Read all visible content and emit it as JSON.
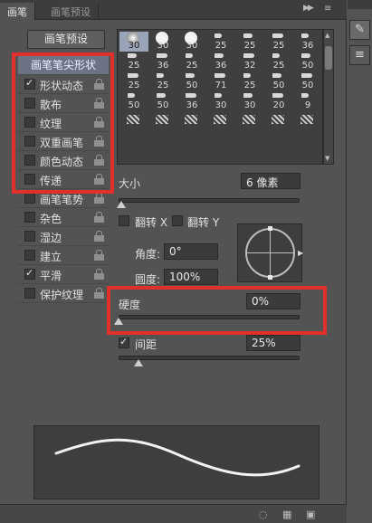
{
  "tabs": [
    {
      "label": "画笔",
      "active": true
    },
    {
      "label": "画笔预设",
      "active": false
    }
  ],
  "preset_button": "画笔预设",
  "options": [
    {
      "label": "画笔笔尖形状",
      "header": true
    },
    {
      "label": "形状动态",
      "checked": true
    },
    {
      "label": "散布",
      "checked": false
    },
    {
      "label": "纹理",
      "checked": false
    },
    {
      "label": "双重画笔",
      "checked": false
    },
    {
      "label": "颜色动态",
      "checked": false
    },
    {
      "label": "传递",
      "checked": false
    },
    {
      "label": "画笔笔势",
      "checked": false
    },
    {
      "label": "杂色",
      "checked": false
    },
    {
      "label": "湿边",
      "checked": false
    },
    {
      "label": "建立",
      "checked": false
    },
    {
      "label": "平滑",
      "checked": true
    },
    {
      "label": "保护纹理",
      "checked": false
    }
  ],
  "brush_sizes": [
    "30",
    "30",
    "30",
    "25",
    "25",
    "25",
    "36",
    "25",
    "36",
    "25",
    "36",
    "32",
    "25",
    "50",
    "25",
    "25",
    "50",
    "71",
    "25",
    "50",
    "50",
    "50",
    "50",
    "36",
    "30",
    "30",
    "20",
    "9",
    "",
    "",
    "",
    "",
    "",
    "",
    ""
  ],
  "size": {
    "label": "大小",
    "value": "6 像素"
  },
  "flip_x": "翻转 X",
  "flip_y": "翻转 Y",
  "angle": {
    "label": "角度:",
    "value": "0°"
  },
  "roundness": {
    "label": "圆度:",
    "value": "100%"
  },
  "hardness": {
    "label": "硬度",
    "value": "0%"
  },
  "spacing": {
    "label": "间距",
    "value": "25%",
    "checked": true
  },
  "colors": {
    "highlight": "#e0302c",
    "selected_cell": "#9aa4b8",
    "header_row": "#6b7385"
  }
}
